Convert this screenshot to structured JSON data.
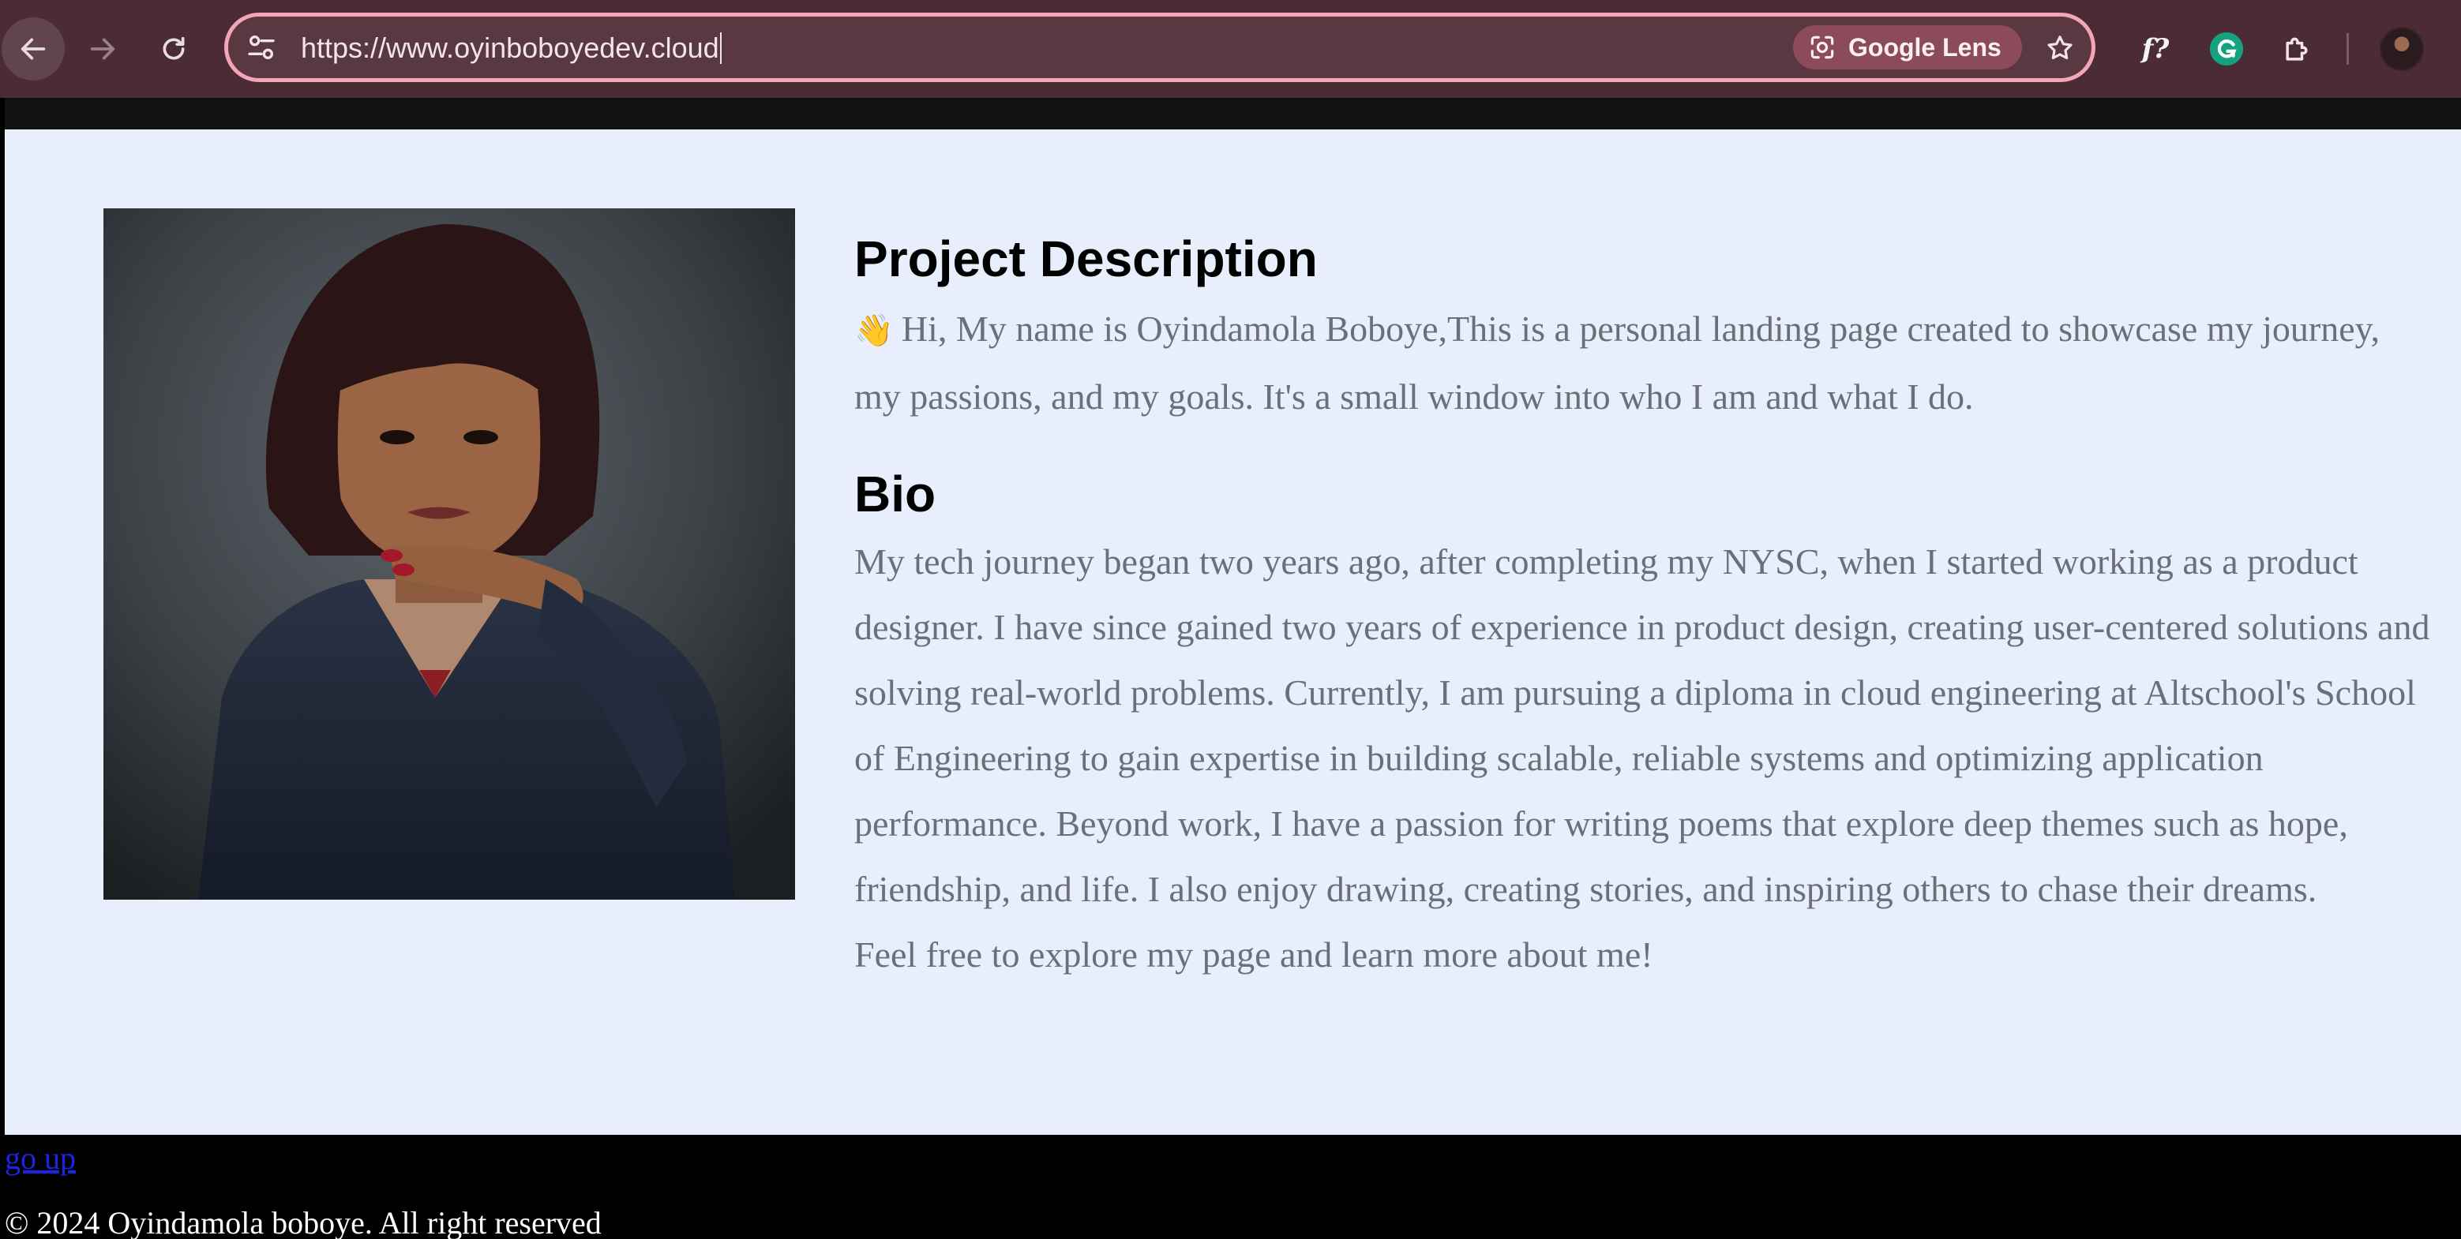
{
  "browser": {
    "url": "https://www.oyinboboyedev.cloud",
    "lens_label": "Google Lens",
    "fx_label": "f?"
  },
  "icons": {
    "back": "arrow-left-icon",
    "forward": "arrow-right-icon",
    "reload": "reload-icon",
    "site_info": "tune-icon",
    "lens": "google-lens-icon",
    "bookmark": "star-icon",
    "fx": "formula-extension-icon",
    "grammarly": "grammarly-icon",
    "extensions": "puzzle-icon",
    "profile": "profile-avatar-icon"
  },
  "colors": {
    "toolbar_bg": "#4b2b35",
    "omnibox_border": "#f2a6b8",
    "page_bg": "#e8eefb",
    "body_text": "#6a7078",
    "link": "#1a24e6"
  },
  "main": {
    "project_heading": "Project Description",
    "wave_emoji": "👋",
    "project_text": "Hi, My name is Oyindamola Boboye,This is a personal landing page created to showcase my journey, my passions, and my goals. It's a small window into who I am and what I do.",
    "bio_heading": "Bio",
    "bio_text": "My tech journey began two years ago, after completing my NYSC, when I started working as a product designer. I have since gained two years of experience in product design, creating user-centered solutions and solving real-world problems. Currently, I am pursuing a diploma in cloud engineering at Altschool's School of Engineering to gain expertise in building scalable, reliable systems and optimizing application performance. Beyond work, I have a passion for writing poems that explore deep themes such as hope, friendship, and life. I also enjoy drawing, creating stories, and inspiring others to chase their dreams.",
    "bio_closing": "Feel free to explore my page and learn more about me!"
  },
  "footer": {
    "go_up_label": "go up",
    "copyright": "© 2024 Oyindamola boboye. All right reserved"
  }
}
